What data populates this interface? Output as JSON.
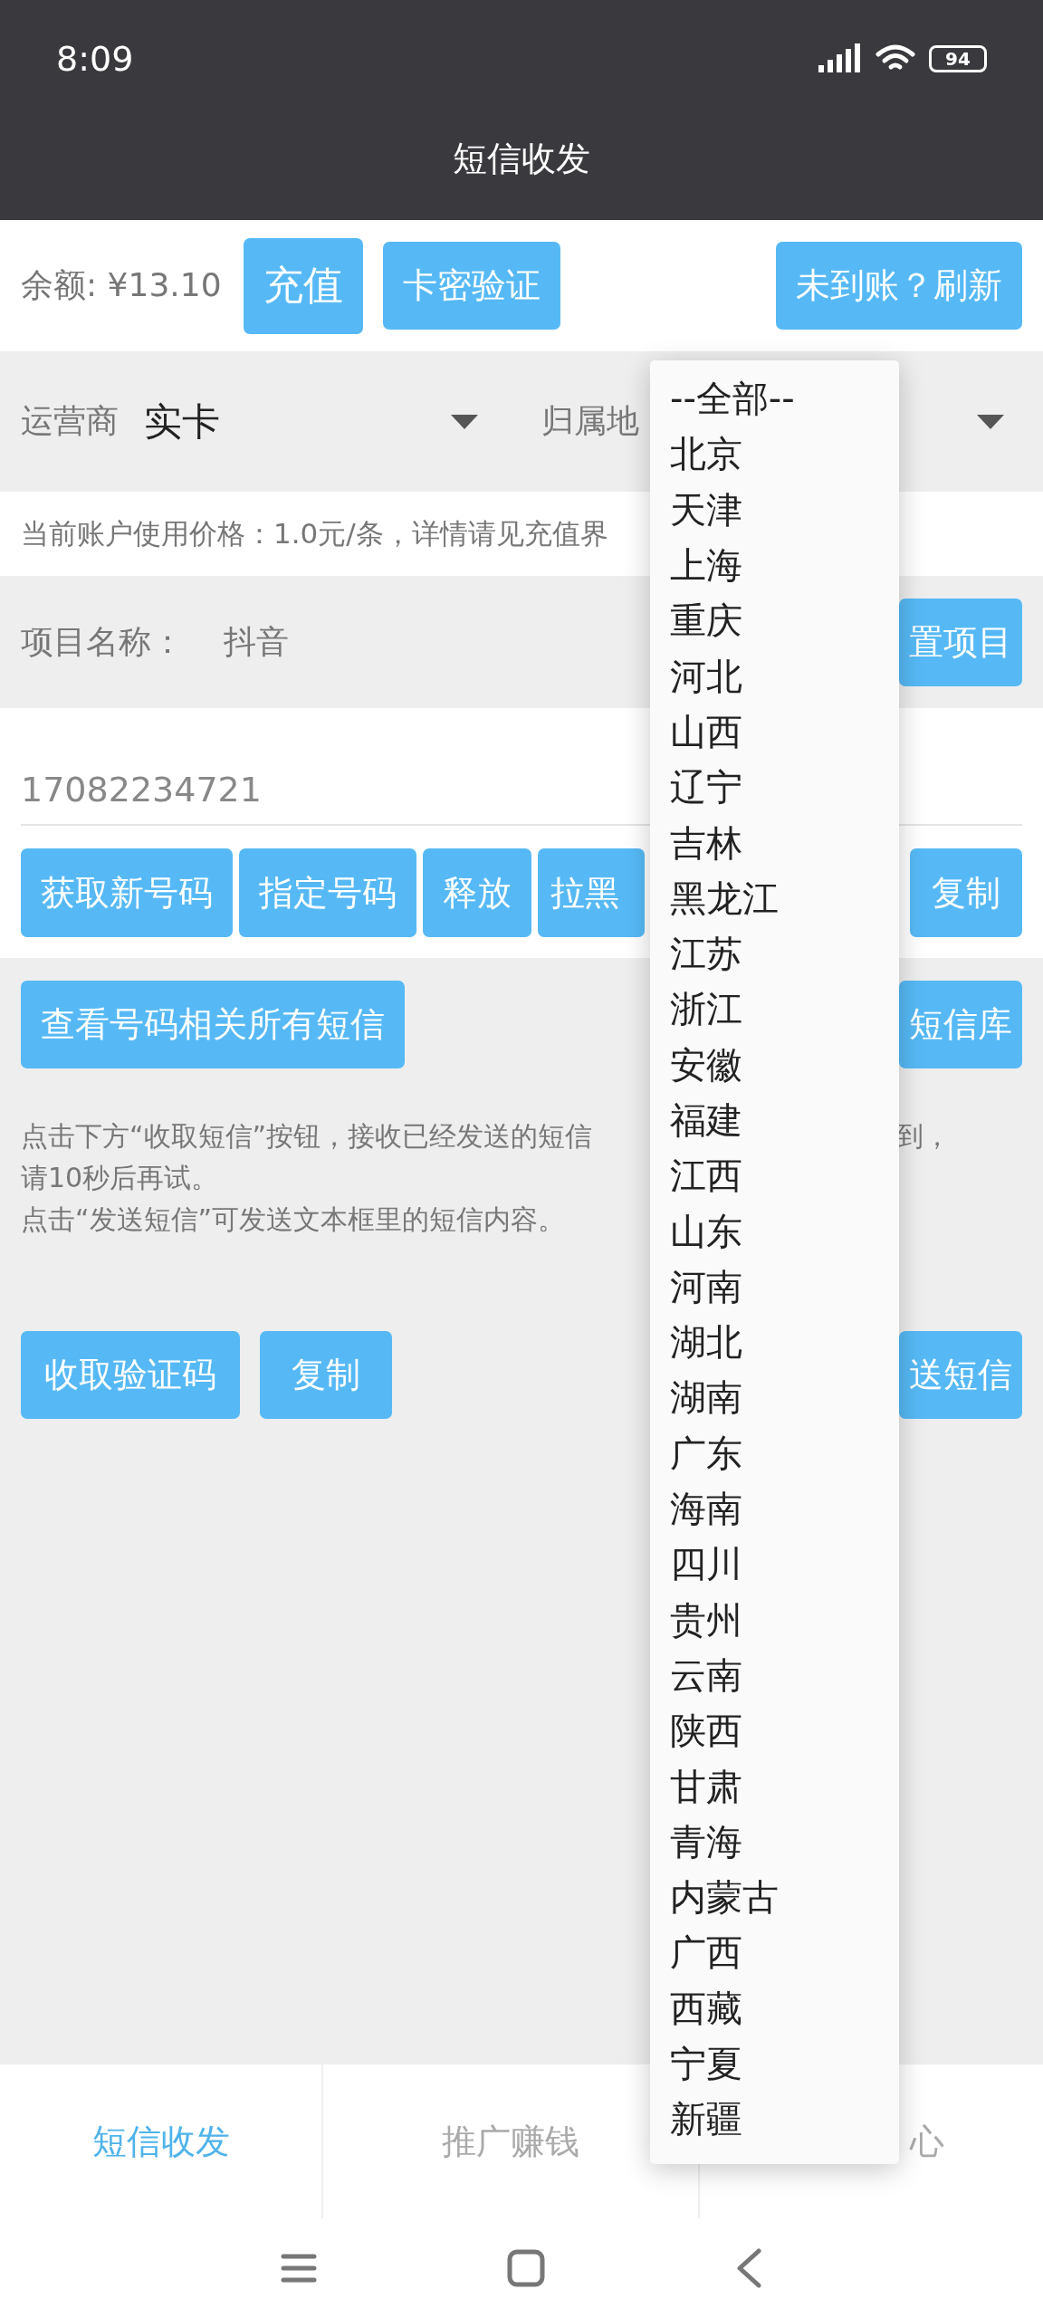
{
  "status_bar": {
    "time": "8:09",
    "battery": "94"
  },
  "header": {
    "title": "短信收发"
  },
  "balance": {
    "text": "余额: ¥13.10",
    "buttons": [
      "充值",
      "卡密验证",
      "未到账？刷新"
    ]
  },
  "filters": [
    {
      "label": "运营商",
      "value": "实卡"
    },
    {
      "label": "归属地"
    }
  ],
  "price_note": "当前账户使用价格：1.0元/条，详情请见充值界",
  "project": {
    "label": "项目名称：",
    "value": "抖音",
    "button": "置项目"
  },
  "phone": {
    "value": "17082234721",
    "buttons": [
      "获取新号码",
      "指定号码",
      "释放",
      "拉黑",
      "复制"
    ]
  },
  "messages": {
    "buttons": [
      "查看号码相关所有短信",
      "短信库"
    ],
    "note": [
      "点击下方“收取短信”按钮，接收已经发送的短信",
      "到，",
      "请10秒后再试。",
      "点击“发送短信”可发送文本框里的短信内容。"
    ],
    "actions": [
      "收取验证码",
      "复制",
      "送短信"
    ]
  },
  "tabs": [
    {
      "label": "短信收发",
      "selected": true
    },
    {
      "label": "推广赚钱",
      "selected": false
    },
    {
      "label": "心",
      "selected": false
    }
  ],
  "dropdown": {
    "items": [
      {
        "label": "--全部--",
        "selected": false
      },
      {
        "label": "北京",
        "selected": false
      },
      {
        "label": "天津",
        "selected": false
      },
      {
        "label": "上海",
        "selected": false
      },
      {
        "label": "重庆",
        "selected": false
      },
      {
        "label": "河北",
        "selected": false
      },
      {
        "label": "山西",
        "selected": false
      },
      {
        "label": "辽宁",
        "selected": false
      },
      {
        "label": "吉林",
        "selected": false
      },
      {
        "label": "黑龙江",
        "selected": false
      },
      {
        "label": "江苏",
        "selected": false
      },
      {
        "label": "浙江",
        "selected": false
      },
      {
        "label": "安徽",
        "selected": false
      },
      {
        "label": "福建",
        "selected": false
      },
      {
        "label": "江西",
        "selected": false
      },
      {
        "label": "山东",
        "selected": false
      },
      {
        "label": "河南",
        "selected": false
      },
      {
        "label": "湖北",
        "selected": false
      },
      {
        "label": "湖南",
        "selected": false
      },
      {
        "label": "广东",
        "selected": false
      },
      {
        "label": "海南",
        "selected": false
      },
      {
        "label": "四川",
        "selected": false
      },
      {
        "label": "贵州",
        "selected": false
      },
      {
        "label": "云南",
        "selected": false
      },
      {
        "label": "陕西",
        "selected": false
      },
      {
        "label": "甘肃",
        "selected": false
      },
      {
        "label": "青海",
        "selected": false
      },
      {
        "label": "内蒙古",
        "selected": false
      },
      {
        "label": "广西",
        "selected": false
      },
      {
        "label": "西藏",
        "selected": false
      },
      {
        "label": "宁夏",
        "selected": false
      },
      {
        "label": "新疆",
        "selected": false
      }
    ]
  }
}
